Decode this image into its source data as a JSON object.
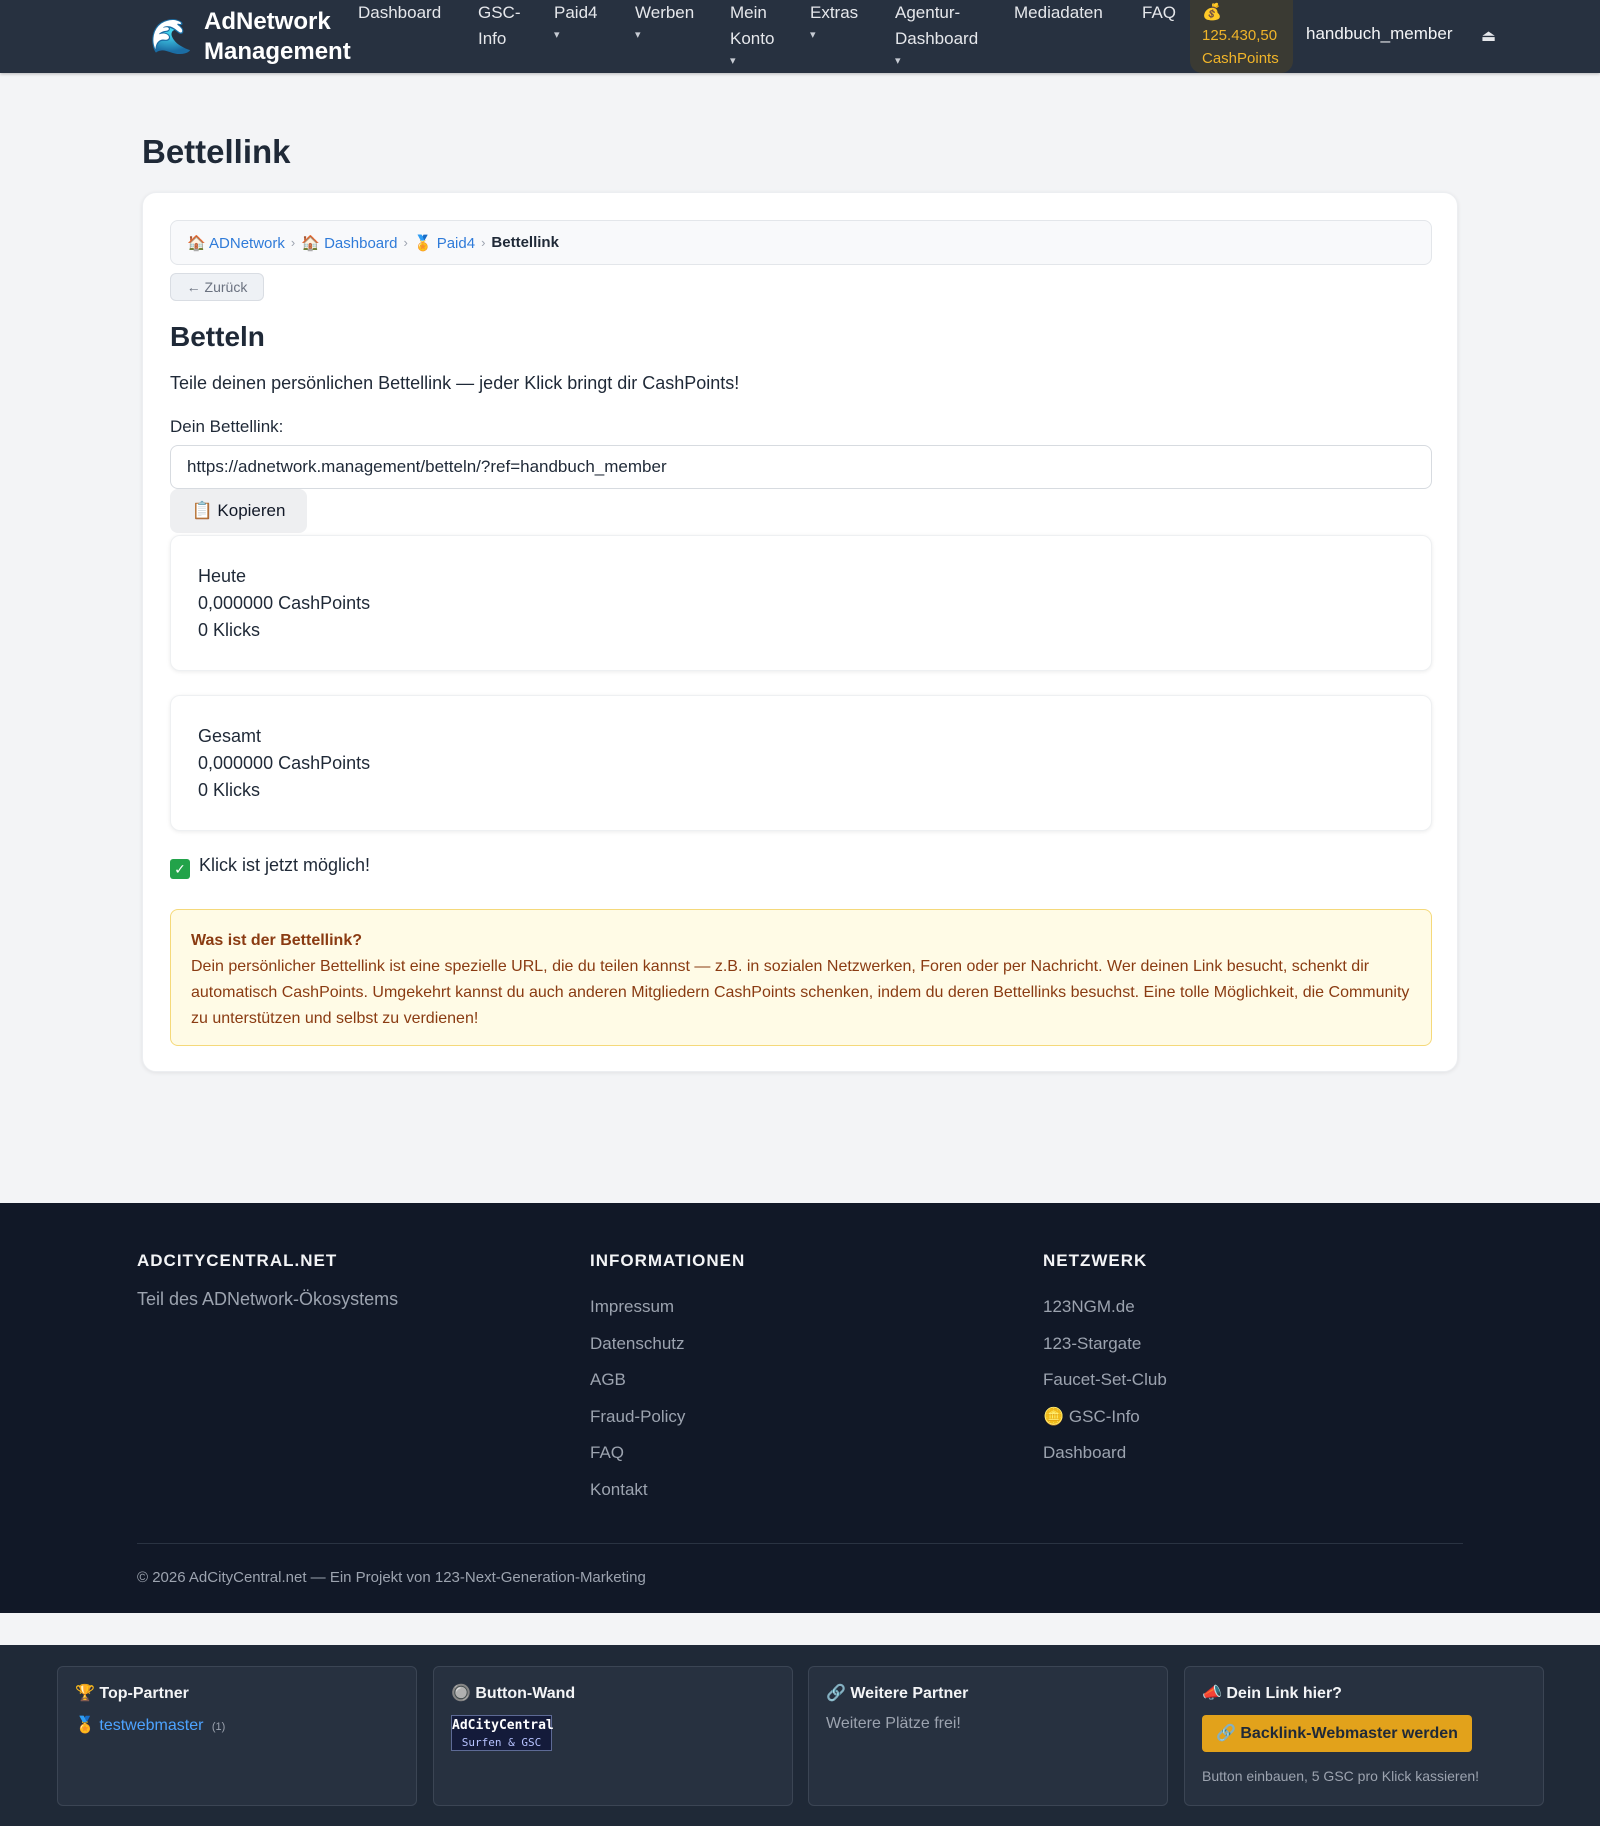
{
  "nav": {
    "brand_icon": "🌊",
    "brand_line1": "AdNetwork",
    "brand_line2": "Management",
    "items": [
      {
        "line1": "Dashboard",
        "line2": "",
        "caret": ""
      },
      {
        "line1": "GSC-",
        "line2": "Info",
        "caret": ""
      },
      {
        "line1": "Paid4",
        "line2": "",
        "caret": "▾"
      },
      {
        "line1": "Werben",
        "line2": "",
        "caret": "▾"
      },
      {
        "line1": "Mein",
        "line2": "Konto",
        "caret": "▾"
      },
      {
        "line1": "Extras",
        "line2": "",
        "caret": "▾"
      },
      {
        "line1": "Agentur-",
        "line2": "Dashboard",
        "caret": "▾"
      },
      {
        "line1": "Mediadaten",
        "line2": "",
        "caret": ""
      },
      {
        "line1": "FAQ",
        "line2": "",
        "caret": ""
      }
    ],
    "cash_icon": "💰",
    "cash_amount": "125.430,50",
    "cash_unit": "CashPoints",
    "user": "handbuch_member",
    "logout_icon": "⏏"
  },
  "page": {
    "title": "Bettellink",
    "breadcrumb": [
      {
        "icon": "🏠",
        "label": "ADNetwork"
      },
      {
        "icon": "🏠",
        "label": "Dashboard"
      },
      {
        "icon": "🏅",
        "label": "Paid4"
      }
    ],
    "breadcrumb_sep": "›",
    "breadcrumb_current": "Bettellink",
    "back_label": "← Zurück",
    "section_title": "Betteln",
    "intro": "Teile deinen persönlichen Bettellink — jeder Klick bringt dir CashPoints!",
    "link_label": "Dein Bettellink:",
    "link_value": "https://adnetwork.management/betteln/?ref=handbuch_member",
    "copy_label": "📋 Kopieren",
    "stats": [
      {
        "label": "Heute",
        "points": "0,000000 CashPoints",
        "clicks": "0 Klicks"
      },
      {
        "label": "Gesamt",
        "points": "0,000000 CashPoints",
        "clicks": "0 Klicks"
      }
    ],
    "status_icon": "✓",
    "status_text": "Klick ist jetzt möglich!",
    "info_title": "Was ist der Bettellink?",
    "info_text": "Dein persönlicher Bettellink ist eine spezielle URL, die du teilen kannst — z.B. in sozialen Netzwerken, Foren oder per Nachricht. Wer deinen Link besucht, schenkt dir automatisch CashPoints. Umgekehrt kannst du auch anderen Mitgliedern CashPoints schenken, indem du deren Bettellinks besuchst. Eine tolle Möglichkeit, die Community zu unterstützen und selbst zu verdienen!"
  },
  "footer": {
    "col1_title": "ADCITYCENTRAL.NET",
    "col1_text": "Teil des ADNetwork-Ökosystems",
    "col2_title": "INFORMATIONEN",
    "col2_links": [
      "Impressum",
      "Datenschutz",
      "AGB",
      "Fraud-Policy",
      "FAQ",
      "Kontakt"
    ],
    "col3_title": "NETZWERK",
    "col3_links": [
      "123NGM.de",
      "123-Stargate",
      "Faucet-Set-Club",
      "🪙 GSC-Info",
      "Dashboard"
    ],
    "copyright": "© 2026 AdCityCentral.net — Ein Projekt von 123-Next-Generation-Marketing"
  },
  "partners": {
    "top_title": "🏆 Top-Partner",
    "top_icon": "🏅",
    "top_link": "testwebmaster",
    "top_count": "(1)",
    "wall_title": "🔘 Button-Wand",
    "wall_banner_line1": "AdCityCentral",
    "wall_banner_line2": "Surfen & GSC",
    "more_title": "🔗 Weitere Partner",
    "more_text": "Weitere Plätze frei!",
    "yours_title": "📣 Dein Link hier?",
    "yours_button": "🔗 Backlink-Webmaster werden",
    "yours_text": "Button einbauen, 5 GSC pro Klick kassieren!"
  }
}
